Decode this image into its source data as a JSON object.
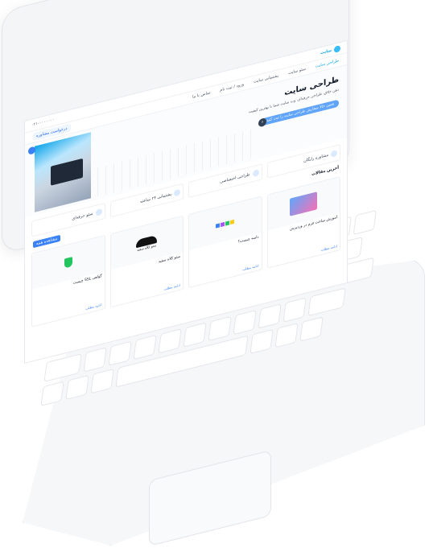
{
  "site": {
    "logo_text": "سایت",
    "top_info": "۰۲۱-۰۰۰۰۰۰۰",
    "consult": "درخواست مشاوره",
    "nav": [
      "طراحی سایت",
      "سئو سایت",
      "پشتیبانی سایت",
      "ورود / ثبت نام",
      "تماس با ما"
    ]
  },
  "hero": {
    "title": "طراحی سایت",
    "desc": "ذهن خلاق، طراحی حرفه‌ای، وب سایت شما با بهترین کیفیت",
    "cta": "همین حالا سفارش طراحی سایت را ثبت کنید"
  },
  "features": [
    "مشاوره رایگان",
    "طراحی اختصاصی",
    "پشتیبانی ۲۴ ساعته",
    "سئو حرفه‌ای"
  ],
  "articles": {
    "title": "آخرین مقالات",
    "all_label": "مشاهده همه",
    "more_label": "ادامه مطلب",
    "items": [
      {
        "title": "آموزش ساخت فرم در وردپرس"
      },
      {
        "title": "دامنه چیست؟"
      },
      {
        "title": "سئو کلاه سفید"
      },
      {
        "title": "گواهی SSL چیست"
      }
    ]
  },
  "hat_label": "سئو کلاه سفید",
  "domain_label": "دامنه چیست؟",
  "colors": {
    "accent": "#3b82f6",
    "sky": "#38bdf8"
  }
}
